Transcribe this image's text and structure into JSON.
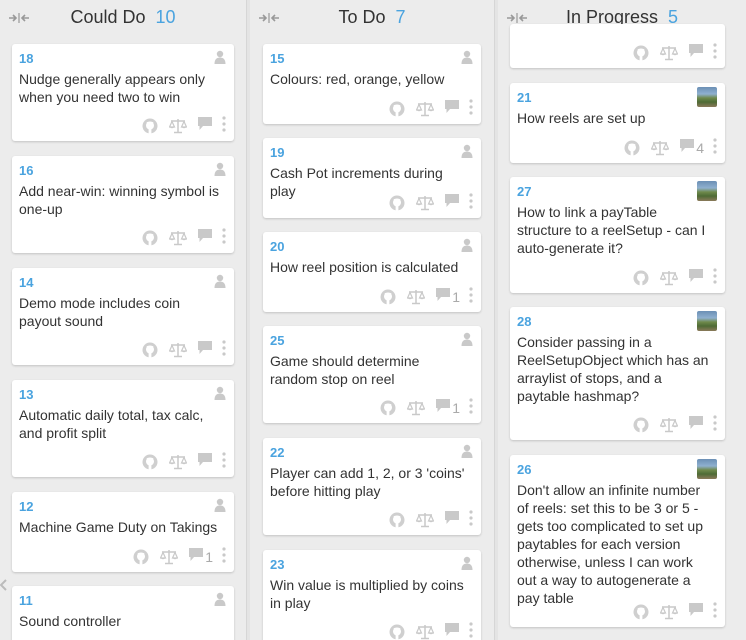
{
  "columns": [
    {
      "title": "Could Do",
      "count": "10",
      "cards": [
        {
          "number": "18",
          "title": "Nudge generally appears only when you need two to win",
          "avatar": "generic",
          "comments": ""
        },
        {
          "number": "16",
          "title": "Add near-win: winning symbol is one-up",
          "avatar": "generic",
          "comments": ""
        },
        {
          "number": "14",
          "title": "Demo mode includes coin payout sound",
          "avatar": "generic",
          "comments": ""
        },
        {
          "number": "13",
          "title": "Automatic daily total, tax calc, and profit split",
          "avatar": "generic",
          "comments": ""
        },
        {
          "number": "12",
          "title": "Machine Game Duty on Takings",
          "avatar": "generic",
          "comments": "1"
        },
        {
          "number": "11",
          "title": "Sound controller",
          "avatar": "generic",
          "comments": ""
        }
      ]
    },
    {
      "title": "To Do",
      "count": "7",
      "cards": [
        {
          "number": "15",
          "title": "Colours: red, orange, yellow",
          "avatar": "generic",
          "comments": ""
        },
        {
          "number": "19",
          "title": "Cash Pot increments during play",
          "avatar": "generic",
          "comments": ""
        },
        {
          "number": "20",
          "title": "How reel position is calculated",
          "avatar": "generic",
          "comments": "1"
        },
        {
          "number": "25",
          "title": "Game should determine random stop on reel",
          "avatar": "generic",
          "comments": "1"
        },
        {
          "number": "22",
          "title": "Player can add 1, 2, or 3 'coins' before hitting play",
          "avatar": "generic",
          "comments": ""
        },
        {
          "number": "23",
          "title": "Win value is multiplied by coins in play",
          "avatar": "generic",
          "comments": ""
        }
      ]
    },
    {
      "title": "In Progress",
      "count": "5",
      "cards": [
        {
          "number": "",
          "title": "",
          "avatar": "",
          "comments": ""
        },
        {
          "number": "21",
          "title": "How reels are set up",
          "avatar": "photo",
          "comments": "4"
        },
        {
          "number": "27",
          "title": "How to link a payTable structure to a reelSetup - can I auto-generate it?",
          "avatar": "photo",
          "comments": ""
        },
        {
          "number": "28",
          "title": "Consider passing in a ReelSetupObject which has an arraylist of stops, and a paytable hashmap?",
          "avatar": "photo",
          "comments": ""
        },
        {
          "number": "26",
          "title": "Don't allow an infinite number of reels: set this to be 3 or 5 - gets too complicated to set up paytables for each version otherwise, unless I can work out a way to autogenerate a pay table",
          "avatar": "photo",
          "comments": ""
        }
      ]
    }
  ],
  "icons": {
    "collapse": "collapse-icon",
    "github": "github-icon",
    "scale": "estimate-scale-icon",
    "comment": "comment-icon",
    "more": "more-dots-icon",
    "user": "user-icon"
  }
}
